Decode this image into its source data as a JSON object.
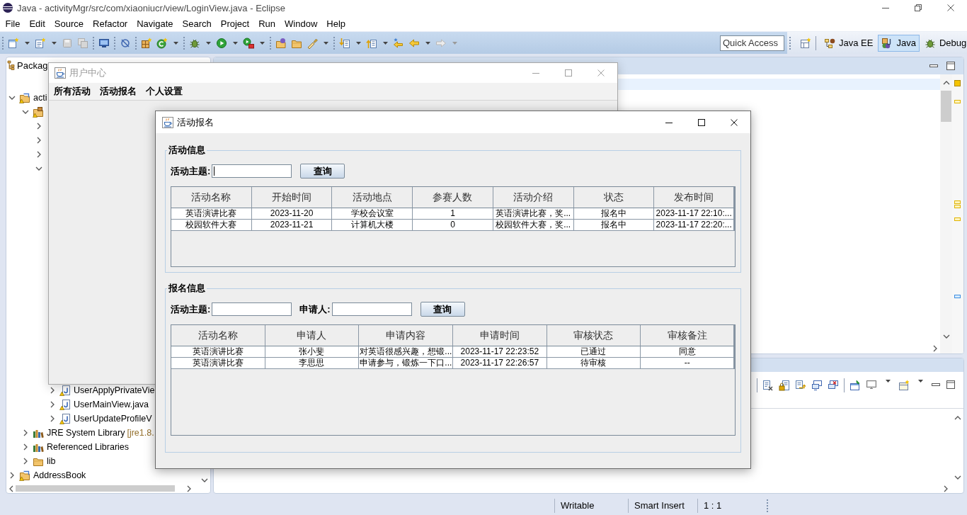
{
  "window": {
    "title": "Java - activityMgr/src/com/xiaoniucr/view/LoginView.java - Eclipse",
    "active": false
  },
  "menu_bar": [
    "File",
    "Edit",
    "Source",
    "Refactor",
    "Navigate",
    "Search",
    "Project",
    "Run",
    "Window",
    "Help"
  ],
  "toolbar": {
    "quick_access": {
      "placeholder": "Quick Access"
    },
    "perspectives": [
      {
        "label": "Java EE",
        "selected": false
      },
      {
        "label": "Java",
        "selected": true
      },
      {
        "label": "Debug",
        "selected": false
      }
    ]
  },
  "package_explorer": {
    "tab": "Packag",
    "tree": [
      {
        "kind": "project",
        "label": "acti",
        "expanded": true,
        "children": [
          {
            "kind": "source-folder",
            "expanded": true,
            "children": [
              {
                "expanded": false
              },
              {
                "expanded": false
              },
              {
                "expanded": false
              },
              {
                "expanded": true,
                "children": [
                  {
                    "kind": "file",
                    "label": "UserApplyPrivateVie",
                    "expanded": false
                  },
                  {
                    "kind": "file",
                    "label": "UserMainView.java",
                    "expanded": false
                  },
                  {
                    "kind": "file",
                    "label": "UserUpdateProfileV",
                    "expanded": false
                  }
                ]
              }
            ]
          },
          {
            "kind": "library",
            "label": "JRE System Library",
            "decoration": "[jre1.8.",
            "expanded": false
          },
          {
            "kind": "library",
            "label": "Referenced Libraries",
            "expanded": false
          },
          {
            "kind": "folder",
            "label": "lib",
            "expanded": false
          }
        ]
      },
      {
        "kind": "project",
        "label": "AddressBook",
        "expanded": false
      }
    ]
  },
  "status_bar": [
    "Writable",
    "Smart Insert",
    "1 : 1"
  ],
  "user_center_window": {
    "title": "用户中心",
    "active": false,
    "menu": [
      "所有活动",
      "活动报名",
      "个人设置"
    ]
  },
  "signup_dialog": {
    "title": "活动报名",
    "active": true,
    "activity_info": {
      "legend": "活动信息",
      "filters": [
        {
          "label": "活动主题:",
          "focused": true
        }
      ],
      "button": "查询",
      "table": {
        "columns": [
          "活动名称",
          "开始时间",
          "活动地点",
          "参赛人数",
          "活动介绍",
          "状态",
          "发布时间"
        ],
        "rows": [
          [
            "英语演讲比赛",
            "2023-11-20",
            "学校会议室",
            "1",
            "英语演讲比赛，奖...",
            "报名中",
            "2023-11-17 22:10:..."
          ],
          [
            "校园软件大赛",
            "2023-11-21",
            "计算机大楼",
            "0",
            "校园软件大赛，奖...",
            "报名中",
            "2023-11-17 22:20:..."
          ]
        ]
      }
    },
    "signup_info": {
      "legend": "报名信息",
      "filters": [
        {
          "label": "活动主题:",
          "focused": false
        },
        {
          "label": "申请人:",
          "focused": false
        }
      ],
      "button": "查询",
      "table": {
        "columns": [
          "活动名称",
          "申请人",
          "申请内容",
          "申请时间",
          "审核状态",
          "审核备注"
        ],
        "rows": [
          [
            "英语演讲比赛",
            "张小斐",
            "对英语很感兴趣，想锻...",
            "2023-11-17 22:23:52",
            "已通过",
            "同意"
          ],
          [
            "英语演讲比赛",
            "李思思",
            "申请参与，锻炼一下口...",
            "2023-11-17 22:26:57",
            "待审核",
            "--"
          ]
        ]
      }
    }
  }
}
